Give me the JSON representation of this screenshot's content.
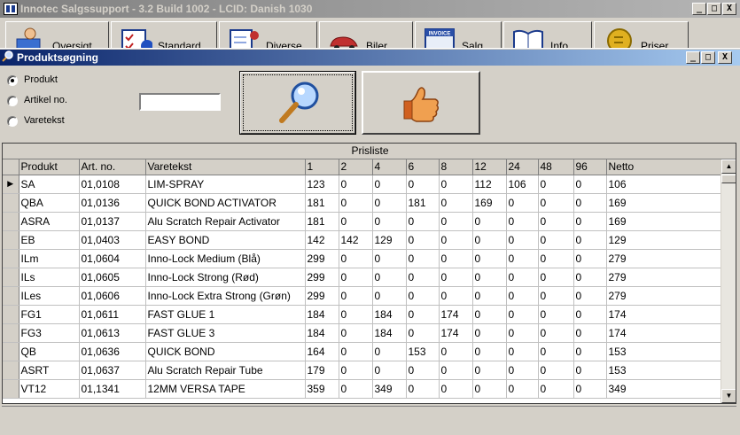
{
  "app": {
    "title": "Innotec Salgssupport -  3.2 Build 1002 - LCID: Danish 1030",
    "caption_buttons": [
      "_",
      "□",
      "X"
    ]
  },
  "toolbar": {
    "buttons": [
      {
        "label": "Oversigt",
        "icon": "computer-user-icon"
      },
      {
        "label": "Standard",
        "icon": "checklist-icon"
      },
      {
        "label": "Diverse",
        "icon": "document-pen-icon"
      },
      {
        "label": "Biler",
        "icon": "car-icon"
      },
      {
        "label": "Salg",
        "icon": "invoice-icon"
      },
      {
        "label": "Info",
        "icon": "book-icon"
      },
      {
        "label": "Priser",
        "icon": "money-icon"
      }
    ],
    "invoice_icon_text": "INVOICE"
  },
  "child": {
    "title": "Produktsøgning",
    "caption_buttons": [
      "_",
      "□",
      "X"
    ]
  },
  "search": {
    "options": [
      {
        "label": "Produkt",
        "checked": true
      },
      {
        "label": "Artikel no.",
        "checked": false
      },
      {
        "label": "Varetekst",
        "checked": false
      }
    ],
    "value": "",
    "search_button_icon": "magnifier-icon",
    "ok_button_icon": "thumbs-up-icon"
  },
  "grid": {
    "caption": "Prisliste",
    "columns": [
      "Produkt",
      "Art. no.",
      "Varetekst",
      "1",
      "2",
      "4",
      "6",
      "8",
      "12",
      "24",
      "48",
      "96",
      "Netto"
    ],
    "current_row_marker": "▶",
    "rows": [
      [
        "SA",
        "01,0108",
        "LIM-SPRAY",
        "123",
        "0",
        "0",
        "0",
        "0",
        "112",
        "106",
        "0",
        "0",
        "106"
      ],
      [
        "QBA",
        "01,0136",
        "QUICK BOND ACTIVATOR",
        "181",
        "0",
        "0",
        "181",
        "0",
        "169",
        "0",
        "0",
        "0",
        "169"
      ],
      [
        "ASRA",
        "01,0137",
        "Alu Scratch Repair Activator",
        "181",
        "0",
        "0",
        "0",
        "0",
        "0",
        "0",
        "0",
        "0",
        "169"
      ],
      [
        "EB",
        "01,0403",
        "EASY BOND",
        "142",
        "142",
        "129",
        "0",
        "0",
        "0",
        "0",
        "0",
        "0",
        "129"
      ],
      [
        "ILm",
        "01,0604",
        "Inno-Lock Medium (Blå)",
        "299",
        "0",
        "0",
        "0",
        "0",
        "0",
        "0",
        "0",
        "0",
        "279"
      ],
      [
        "ILs",
        "01,0605",
        "Inno-Lock Strong (Rød)",
        "299",
        "0",
        "0",
        "0",
        "0",
        "0",
        "0",
        "0",
        "0",
        "279"
      ],
      [
        "ILes",
        "01,0606",
        "Inno-Lock Extra Strong (Grøn)",
        "299",
        "0",
        "0",
        "0",
        "0",
        "0",
        "0",
        "0",
        "0",
        "279"
      ],
      [
        "FG1",
        "01,0611",
        "FAST GLUE 1",
        "184",
        "0",
        "184",
        "0",
        "174",
        "0",
        "0",
        "0",
        "0",
        "174"
      ],
      [
        "FG3",
        "01,0613",
        "FAST GLUE 3",
        "184",
        "0",
        "184",
        "0",
        "174",
        "0",
        "0",
        "0",
        "0",
        "174"
      ],
      [
        "QB",
        "01,0636",
        "QUICK BOND",
        "164",
        "0",
        "0",
        "153",
        "0",
        "0",
        "0",
        "0",
        "0",
        "153"
      ],
      [
        "ASRT",
        "01,0637",
        "Alu Scratch Repair Tube",
        "179",
        "0",
        "0",
        "0",
        "0",
        "0",
        "0",
        "0",
        "0",
        "153"
      ],
      [
        "VT12",
        "01,1341",
        "12MM VERSA TAPE",
        "359",
        "0",
        "349",
        "0",
        "0",
        "0",
        "0",
        "0",
        "0",
        "349"
      ]
    ],
    "scroll_up": "▲",
    "scroll_down": "▼"
  },
  "colors": {
    "title_active": "#0a246a",
    "title_inactive": "#808080",
    "face": "#d4d0c8"
  }
}
